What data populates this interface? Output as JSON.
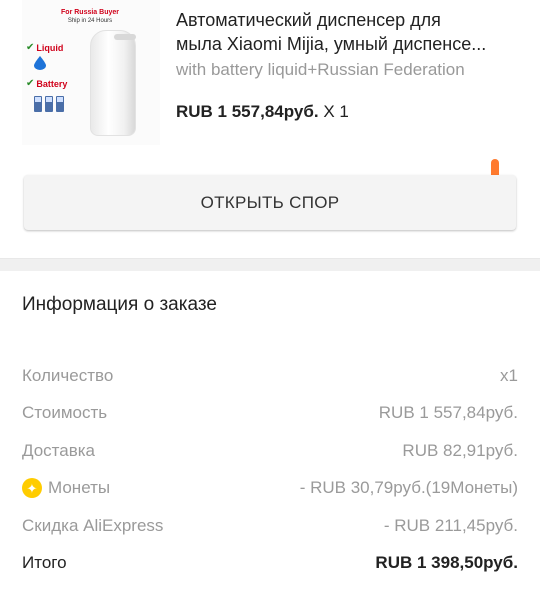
{
  "product": {
    "image_text": {
      "banner_title": "For Russia Buyer",
      "banner_sub": "Ship in 24 Hours",
      "feature1": "Liquid",
      "feature2": "Battery"
    },
    "title_line1": "Автоматический диспенсер для",
    "title_line2": "мыла Xiaomi Mijia, умный диспенсе...",
    "variant": "with battery liquid+Russian Federation",
    "price": "RUB 1 557,84руб.",
    "quantity": "X 1"
  },
  "dispute_button": {
    "label": "ОТКРЫТЬ СПОР"
  },
  "order_info": {
    "title": "Информация о заказе",
    "rows": [
      {
        "label": "Количество",
        "value": "x1"
      },
      {
        "label": "Стоимость",
        "value": "RUB 1 557,84руб."
      },
      {
        "label": "Доставка",
        "value": "RUB 82,91руб."
      },
      {
        "label": "Монеты",
        "value": "- RUB 30,79руб.(19Монеты)",
        "icon": "coin-icon"
      },
      {
        "label": "Скидка AliExpress",
        "value": "- RUB 211,45руб."
      }
    ],
    "total": {
      "label": "Итого",
      "value": "RUB 1 398,50руб."
    }
  },
  "colors": {
    "accent": "#ff7a2e",
    "coin": "#ffcc00",
    "muted_text": "#9a9a9a",
    "button_bg": "#f4f4f4"
  }
}
